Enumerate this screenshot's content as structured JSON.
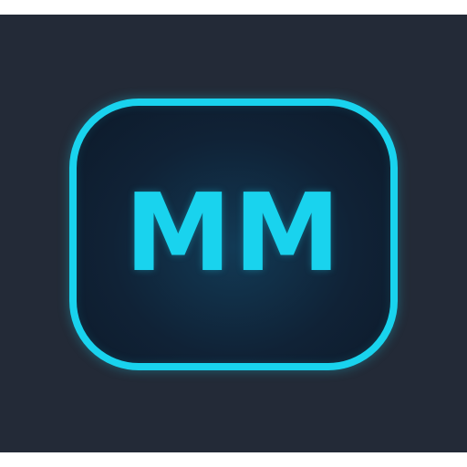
{
  "logo": {
    "text": "MM",
    "accent_color": "#19d3ee",
    "background_color": "#232a37"
  }
}
